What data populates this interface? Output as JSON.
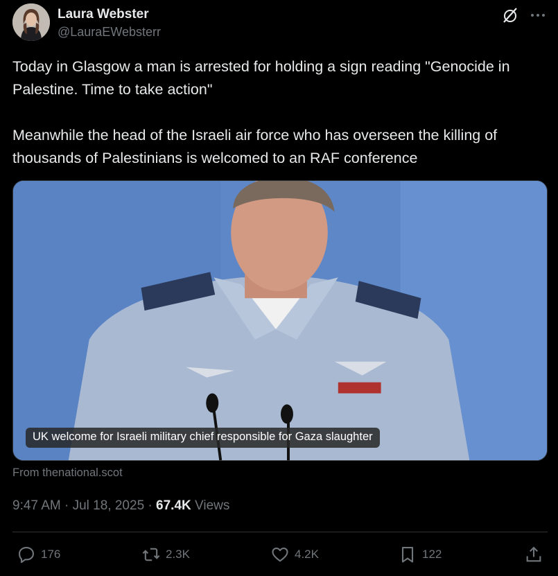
{
  "author": {
    "display_name": "Laura Webster",
    "handle": "@LauraEWebsterr"
  },
  "tweet": {
    "paragraphs": [
      "Today in Glasgow a man is arrested for holding a sign reading \"Genocide in Palestine. Time to take action\"",
      "Meanwhile the head of the Israeli air force who has overseen the killing of thousands of Palestinians is welcomed to an RAF conference"
    ]
  },
  "media": {
    "caption": "UK welcome for Israeli military chief responsible for Gaza slaughter",
    "source": "From thenational.scot"
  },
  "meta": {
    "time": "9:47 AM",
    "separator": " · ",
    "date": "Jul 18, 2025",
    "views_count": "67.4K",
    "views_label": " Views"
  },
  "actions": {
    "replies": "176",
    "reposts": "2.3K",
    "likes": "4.2K",
    "bookmarks": "122"
  },
  "icons": {
    "grok": "grok-icon",
    "more": "more-icon",
    "reply": "reply-icon",
    "repost": "repost-icon",
    "like": "heart-icon",
    "bookmark": "bookmark-icon",
    "share": "share-icon"
  },
  "colors": {
    "background": "#000000",
    "text": "#e7e9ea",
    "secondary": "#71767b",
    "border": "#2f3336"
  }
}
